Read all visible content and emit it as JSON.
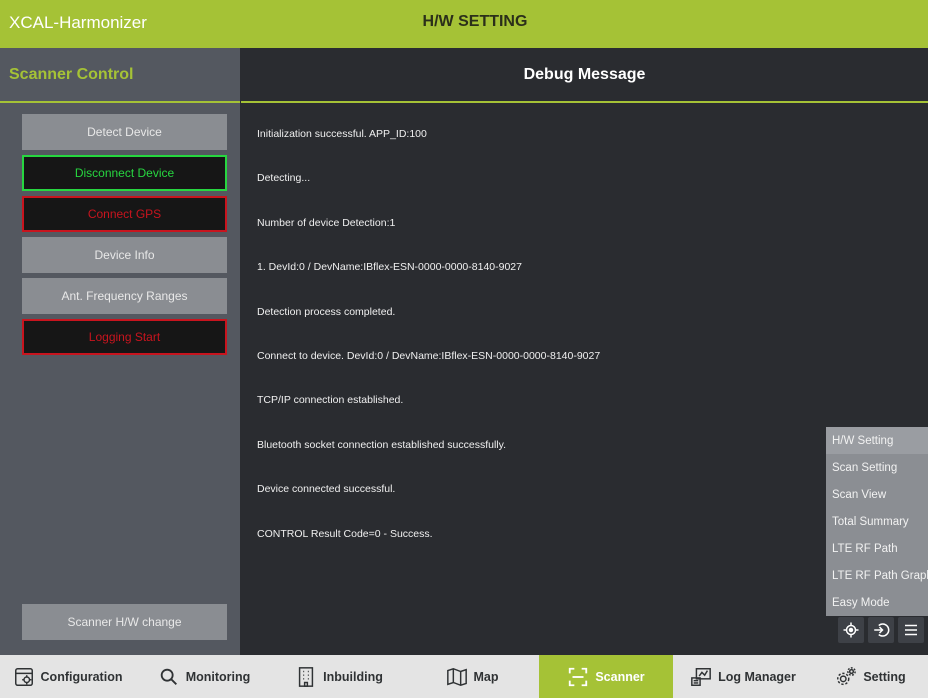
{
  "app": {
    "title": "XCAL-Harmonizer",
    "page_title": "H/W SETTING"
  },
  "sidebar": {
    "title": "Scanner Control",
    "buttons": [
      {
        "label": "Detect Device",
        "style": "gray"
      },
      {
        "label": "Disconnect Device",
        "style": "green"
      },
      {
        "label": "Connect GPS",
        "style": "red"
      },
      {
        "label": "Device Info",
        "style": "gray"
      },
      {
        "label": "Ant. Frequency Ranges",
        "style": "gray"
      },
      {
        "label": "Logging Start",
        "style": "red"
      }
    ],
    "bottom_button": "Scanner H/W change"
  },
  "content": {
    "title": "Debug Message",
    "messages": [
      "Initialization successful.  APP_ID:100",
      "Detecting...",
      "Number of device Detection:1",
      "1. DevId:0 / DevName:IBflex-ESN-0000-0000-8140-9027",
      "Detection process completed.",
      "Connect to device.  DevId:0 / DevName:IBflex-ESN-0000-0000-8140-9027",
      "TCP/IP connection established.",
      "Bluetooth socket connection established successfully.",
      "Device connected successful.",
      "CONTROL Result Code=0 - Success."
    ]
  },
  "popup_menu": {
    "items": [
      "H/W Setting",
      "Scan Setting",
      "Scan View",
      "Total Summary",
      "LTE RF Path",
      "LTE RF Path Graph",
      "Easy Mode"
    ]
  },
  "floating_buttons": {
    "icons": [
      "crosshair-icon",
      "login-icon",
      "menu-icon"
    ]
  },
  "nav": {
    "tabs": [
      {
        "label": "Configuration",
        "icon": "configuration-icon"
      },
      {
        "label": "Monitoring",
        "icon": "search-icon"
      },
      {
        "label": "Inbuilding",
        "icon": "building-icon"
      },
      {
        "label": "Map",
        "icon": "map-icon"
      },
      {
        "label": "Scanner",
        "icon": "scanner-icon"
      },
      {
        "label": "Log Manager",
        "icon": "log-manager-icon"
      },
      {
        "label": "Setting",
        "icon": "gears-icon"
      }
    ],
    "active": "Scanner"
  },
  "colors": {
    "accent": "#a5c236",
    "dark_bg": "#2a2c30",
    "sidebar_bg": "#545860",
    "connected_green": "#27d640",
    "alert_red": "#c8141e"
  }
}
